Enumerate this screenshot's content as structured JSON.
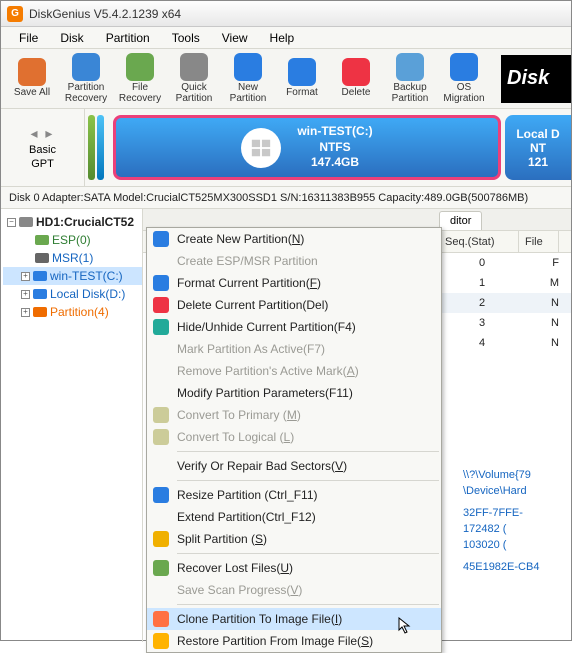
{
  "title": "DiskGenius V5.4.2.1239 x64",
  "menu": [
    "File",
    "Disk",
    "Partition",
    "Tools",
    "View",
    "Help"
  ],
  "toolbar": [
    {
      "label": "Save All",
      "color": "#e07030"
    },
    {
      "label": "Partition\nRecovery",
      "color": "#3a86d6"
    },
    {
      "label": "File\nRecovery",
      "color": "#6aa84f"
    },
    {
      "label": "Quick\nPartition",
      "color": "#888"
    },
    {
      "label": "New\nPartition",
      "color": "#2a7de1"
    },
    {
      "label": "Format",
      "color": "#2a7de1"
    },
    {
      "label": "Delete",
      "color": "#e34"
    },
    {
      "label": "Backup\nPartition",
      "color": "#5aa0d8"
    },
    {
      "label": "OS Migration",
      "color": "#2a7de1"
    }
  ],
  "brand": "Disk",
  "diskbar": {
    "leftLabel1": "Basic",
    "leftLabel2": "GPT",
    "main": {
      "name": "win-TEST(C:)",
      "fs": "NTFS",
      "size": "147.4GB"
    },
    "side": {
      "name": "Local D",
      "fs": "NT",
      "size": "121"
    }
  },
  "diskinfo": "Disk 0  Adapter:SATA   Model:CrucialCT525MX300SSD1   S/N:16311383B955   Capacity:489.0GB(500786MB)   ",
  "tree": {
    "root": "HD1:CrucialCT52",
    "items": [
      {
        "label": "ESP(0)",
        "cls": "green"
      },
      {
        "label": "MSR(1)",
        "cls": ""
      },
      {
        "label": "win-TEST(C:)",
        "cls": "blue",
        "sel": true
      },
      {
        "label": "Local Disk(D:)",
        "cls": "blue"
      },
      {
        "label": "Partition(4)",
        "cls": "orange"
      }
    ]
  },
  "tab": "ditor",
  "table": {
    "cols": [
      "Seq.(Stat)",
      "File"
    ],
    "rows": [
      {
        "seq": "0",
        "f": "F"
      },
      {
        "seq": "1",
        "f": "M"
      },
      {
        "seq": "2",
        "f": "N",
        "shade": true
      },
      {
        "seq": "3",
        "f": "N"
      },
      {
        "seq": "4",
        "f": "N"
      }
    ]
  },
  "detail": {
    "l1": "\\\\?\\Volume{79",
    "l2": "\\Device\\Hard",
    "l3": "32FF-7FFE-",
    "l4": "172482 (",
    "l5": "103020 (",
    "l6": "45E1982E-CB4"
  },
  "ctx": [
    {
      "t": "item",
      "html": "Create New Partition(<u>N</u>)",
      "ico": "#2a7de1"
    },
    {
      "t": "item",
      "html": "Create ESP/MSR Partition",
      "disabled": true
    },
    {
      "t": "item",
      "html": "Format Current Partition(<u>F</u>)",
      "ico": "#2a7de1"
    },
    {
      "t": "item",
      "html": "Delete Current Partition(Del)",
      "ico": "#e34"
    },
    {
      "t": "item",
      "html": "Hide/Unhide Current Partition(F4)",
      "ico": "#2a9"
    },
    {
      "t": "item",
      "html": "Mark Partition As Active(F7)",
      "disabled": true
    },
    {
      "t": "item",
      "html": "Remove Partition's Active Mark(<u>A</u>)",
      "disabled": true
    },
    {
      "t": "item",
      "html": "Modify Partition Parameters(F11)"
    },
    {
      "t": "item",
      "html": "Convert To Primary (<u>M</u>)",
      "disabled": true,
      "ico": "#cc9"
    },
    {
      "t": "item",
      "html": "Convert To Logical (<u>L</u>)",
      "disabled": true,
      "ico": "#cc9"
    },
    {
      "t": "sep"
    },
    {
      "t": "item",
      "html": "Verify Or Repair Bad Sectors(<u>V</u>)"
    },
    {
      "t": "sep"
    },
    {
      "t": "item",
      "html": "Resize Partition (Ctrl_F11)",
      "ico": "#2a7de1"
    },
    {
      "t": "item",
      "html": "Extend Partition(Ctrl_F12)"
    },
    {
      "t": "item",
      "html": "Split Partition (<u>S</u>)",
      "ico": "#f0b000"
    },
    {
      "t": "sep"
    },
    {
      "t": "item",
      "html": "Recover Lost Files(<u>U</u>)",
      "ico": "#6aa84f"
    },
    {
      "t": "item",
      "html": "Save Scan Progress(<u>V</u>)",
      "disabled": true
    },
    {
      "t": "sep"
    },
    {
      "t": "item",
      "html": "Clone Partition To Image File(<u>I</u>)",
      "hl": true,
      "ico": "#ff7043"
    },
    {
      "t": "item",
      "html": "Restore Partition From Image File(<u>S</u>)",
      "ico": "#ffb300"
    }
  ]
}
